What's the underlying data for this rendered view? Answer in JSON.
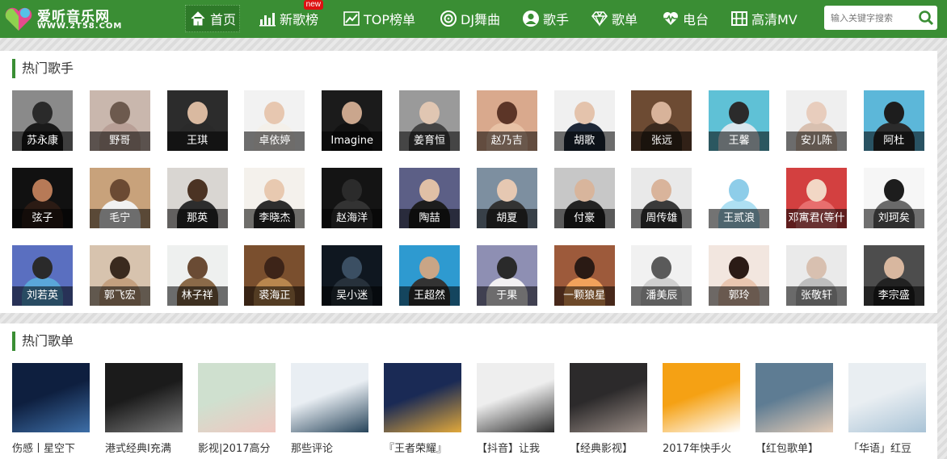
{
  "brand": {
    "name": "爱听音乐网",
    "url": "WWW.2T58.COM"
  },
  "nav": [
    {
      "label": "首页",
      "icon": "home-icon",
      "active": true
    },
    {
      "label": "新歌榜",
      "icon": "bar-chart-icon",
      "badge": "new"
    },
    {
      "label": "TOP榜单",
      "icon": "trend-line-icon"
    },
    {
      "label": "DJ舞曲",
      "icon": "dj-disc-icon"
    },
    {
      "label": "歌手",
      "icon": "user-icon"
    },
    {
      "label": "歌单",
      "icon": "diamond-icon"
    },
    {
      "label": "电台",
      "icon": "heartbeat-icon"
    },
    {
      "label": "高清MV",
      "icon": "film-icon"
    }
  ],
  "search": {
    "placeholder": "输入关键字搜索",
    "icon": "search-icon"
  },
  "colors": {
    "brand_green": "#3a8e34",
    "badge_red": "#dd1111"
  },
  "hot_singers": {
    "title": "热门歌手",
    "items": [
      "苏永康",
      "野哥",
      "王琪",
      "卓依婷",
      "Imagine",
      "姜育恒",
      "赵乃吉",
      "胡歌",
      "张远",
      "王馨",
      "安儿陈",
      "阿杜",
      "弦子",
      "毛宁",
      "那英",
      "李晓杰",
      "赵海洋",
      "陶喆",
      "胡夏",
      "付豪",
      "周传雄",
      "王贰浪",
      "邓寓君(等什",
      "刘珂矣",
      "刘若英",
      "郭飞宏",
      "林子祥",
      "裘海正",
      "吴小迷",
      "王超然",
      "于果",
      "一颗狼星",
      "潘美辰",
      "郭玲",
      "张敬轩",
      "李宗盛"
    ]
  },
  "hot_playlists": {
    "title": "热门歌单",
    "items": [
      "伤感丨星空下",
      "港式经典I充满",
      "影视|2017高分",
      "那些评论",
      "『王者荣耀』",
      "【抖音】让我",
      "【经典影视】",
      "2017年快手火",
      "【红包歌单】",
      "「华语」红豆"
    ]
  }
}
